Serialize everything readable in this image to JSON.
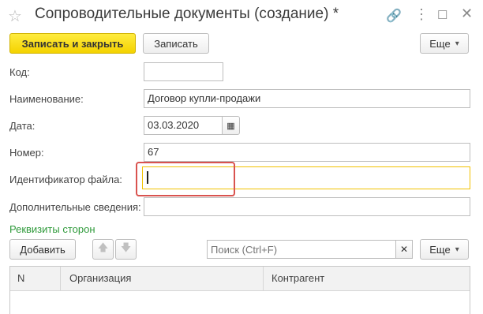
{
  "window": {
    "title": "Сопроводительные документы (создание) *"
  },
  "toolbar": {
    "save_close_label": "Записать и закрыть",
    "save_label": "Записать",
    "more_label": "Еще"
  },
  "form": {
    "code_label": "Код:",
    "code_value": "",
    "name_label": "Наименование:",
    "name_value": "Договор купли-продажи",
    "date_label": "Дата:",
    "date_value": "03.03.2020",
    "number_label": "Номер:",
    "number_value": "67",
    "file_id_label": "Идентификатор файла:",
    "file_id_value": "",
    "extra_label": "Дополнительные сведения:",
    "extra_value": ""
  },
  "parties": {
    "section_title": "Реквизиты сторон",
    "add_label": "Добавить",
    "search_placeholder": "Поиск (Ctrl+F)",
    "more_label": "Еще",
    "columns": [
      "N",
      "Организация",
      "Контрагент"
    ]
  },
  "colors": {
    "accent_yellow": "#f4d200",
    "section_green": "#2f9a3b",
    "focus_border": "#f2c200",
    "highlight_red": "#d9534f"
  }
}
